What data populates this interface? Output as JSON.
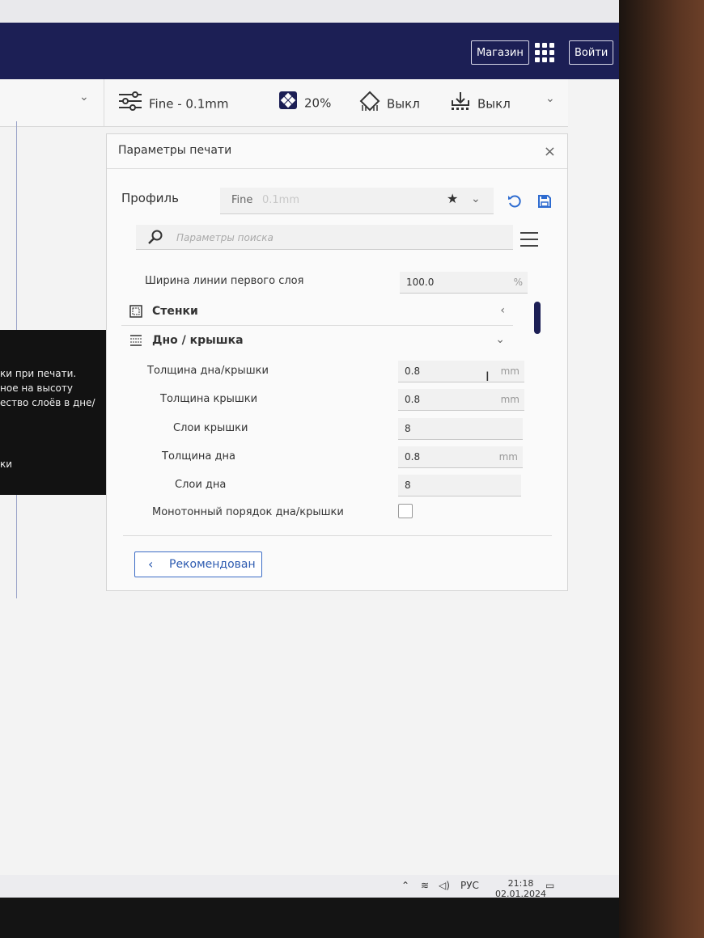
{
  "header": {
    "store_label": "Магазин",
    "login_label": "Войти"
  },
  "toolbar": {
    "profile_label": "Fine - 0.1mm",
    "infill_label": "20%",
    "support_label": "Выкл",
    "adhesion_label": "Выкл"
  },
  "tooltip": {
    "lines": [
      "ки при печати.",
      "ное на высоту",
      "ество слоёв в дне/",
      "ки"
    ]
  },
  "dialog": {
    "title": "Параметры печати",
    "close_label": "×",
    "profile_label": "Профиль",
    "profile_name": "Fine",
    "profile_sub": "0.1mm",
    "search_placeholder": "Параметры поиска",
    "first_row": {
      "label": "Ширина линии первого слоя",
      "value": "100.0",
      "unit": "%"
    },
    "sections": [
      {
        "label": "Стенки",
        "icon": "walls-icon",
        "expanded": false
      },
      {
        "label": "Дно / крышка",
        "icon": "top-bottom-icon",
        "expanded": true
      }
    ],
    "settings": [
      {
        "label": "Толщина дна/крышки",
        "value": "0.8",
        "unit": "mm"
      },
      {
        "label": "Толщина крышки",
        "value": "0.8",
        "unit": "mm"
      },
      {
        "label": "Слои крышки",
        "value": "8",
        "unit": ""
      },
      {
        "label": "Толщина дна",
        "value": "0.8",
        "unit": "mm"
      },
      {
        "label": "Слои дна",
        "value": "8",
        "unit": ""
      },
      {
        "label": "Монотонный порядок дна/крышки",
        "checked": false
      }
    ],
    "recommended_label": "Рекомендован"
  },
  "taskbar": {
    "language": "РУС",
    "time": "21:18",
    "date": "02.01.2024"
  },
  "colors": {
    "header_bg": "#1c1f55",
    "accent": "#3d6dc6"
  }
}
